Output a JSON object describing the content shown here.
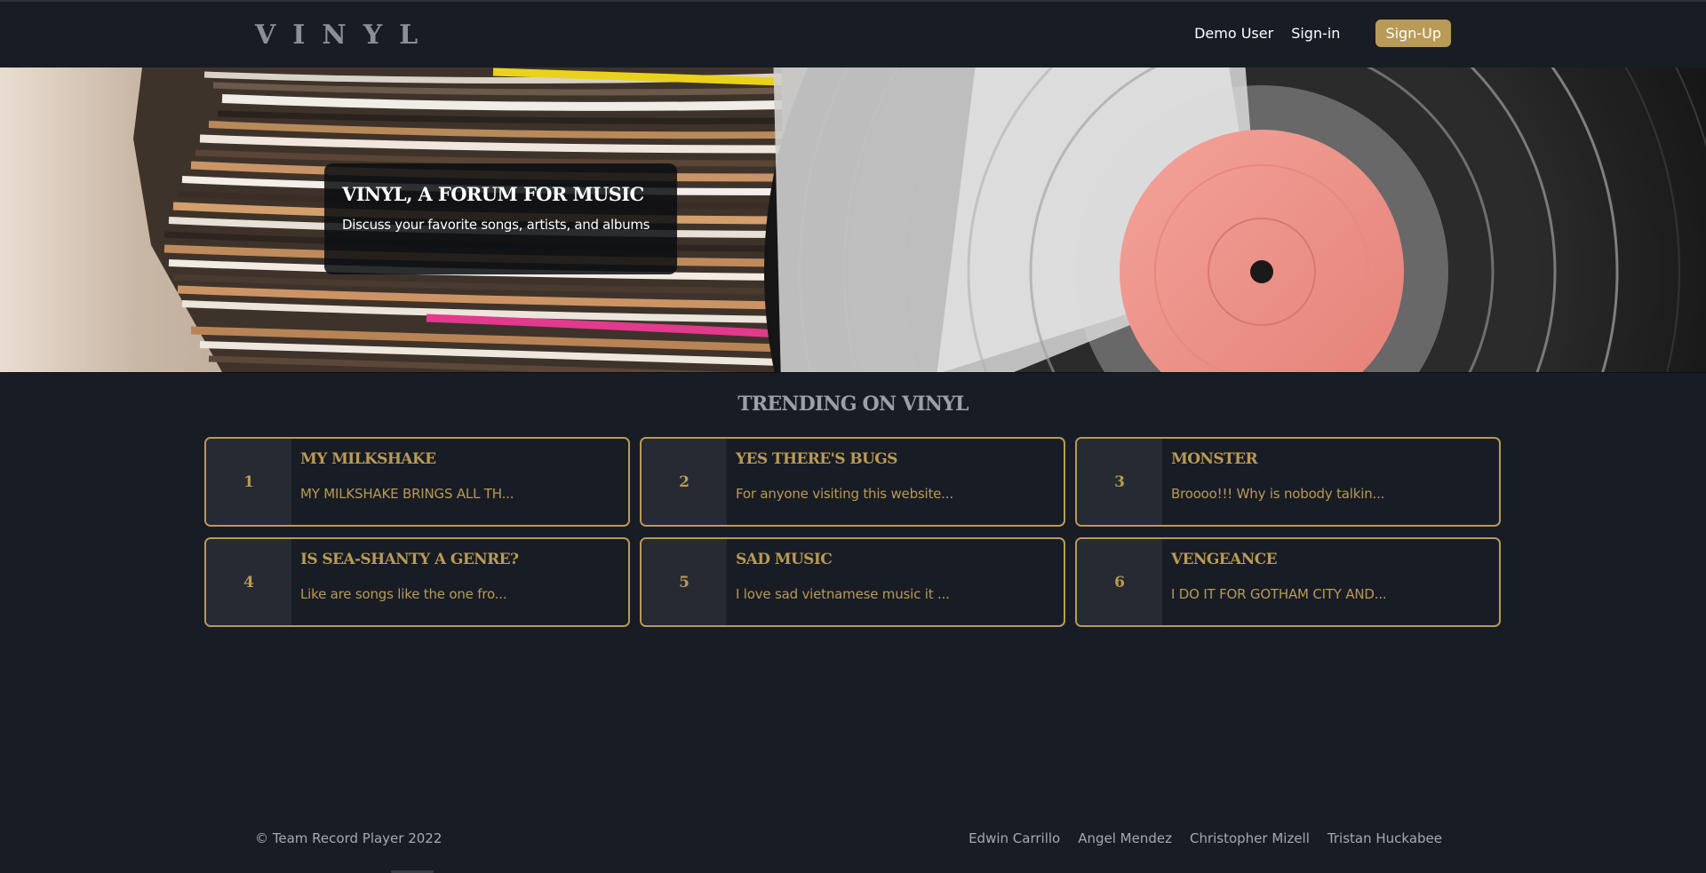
{
  "nav": {
    "logo": "VINYL",
    "demo_user": "Demo User",
    "sign_in": "Sign-in",
    "sign_up": "Sign-Up"
  },
  "hero": {
    "title": "VINYL, A FORUM FOR MUSIC",
    "subtitle": "Discuss your favorite songs, artists, and albums"
  },
  "trending": {
    "heading": "TRENDING ON VINYL",
    "items": [
      {
        "rank": "1",
        "title": "MY MILKSHAKE",
        "excerpt": "MY MILKSHAKE BRINGS ALL TH..."
      },
      {
        "rank": "2",
        "title": "YES THERE'S BUGS",
        "excerpt": "For anyone visiting this website..."
      },
      {
        "rank": "3",
        "title": "MONSTER",
        "excerpt": "Broooo!!! Why is nobody talkin..."
      },
      {
        "rank": "4",
        "title": "IS SEA-SHANTY A GENRE?",
        "excerpt": "Like are songs like the one fro..."
      },
      {
        "rank": "5",
        "title": "SAD MUSIC",
        "excerpt": "I love sad vietnamese music it ..."
      },
      {
        "rank": "6",
        "title": "VENGEANCE",
        "excerpt": "I DO IT FOR GOTHAM CITY AND..."
      }
    ]
  },
  "footer": {
    "copyright": "© Team Record Player 2022",
    "names": [
      "Edwin Carrillo",
      "Angel Mendez",
      "Christopher Mizell",
      "Tristan Huckabee"
    ]
  },
  "colors": {
    "background": "#181c25",
    "accent_gold": "#b99a56",
    "rank_cell": "#262a32",
    "muted_text": "#a6a9ae"
  }
}
